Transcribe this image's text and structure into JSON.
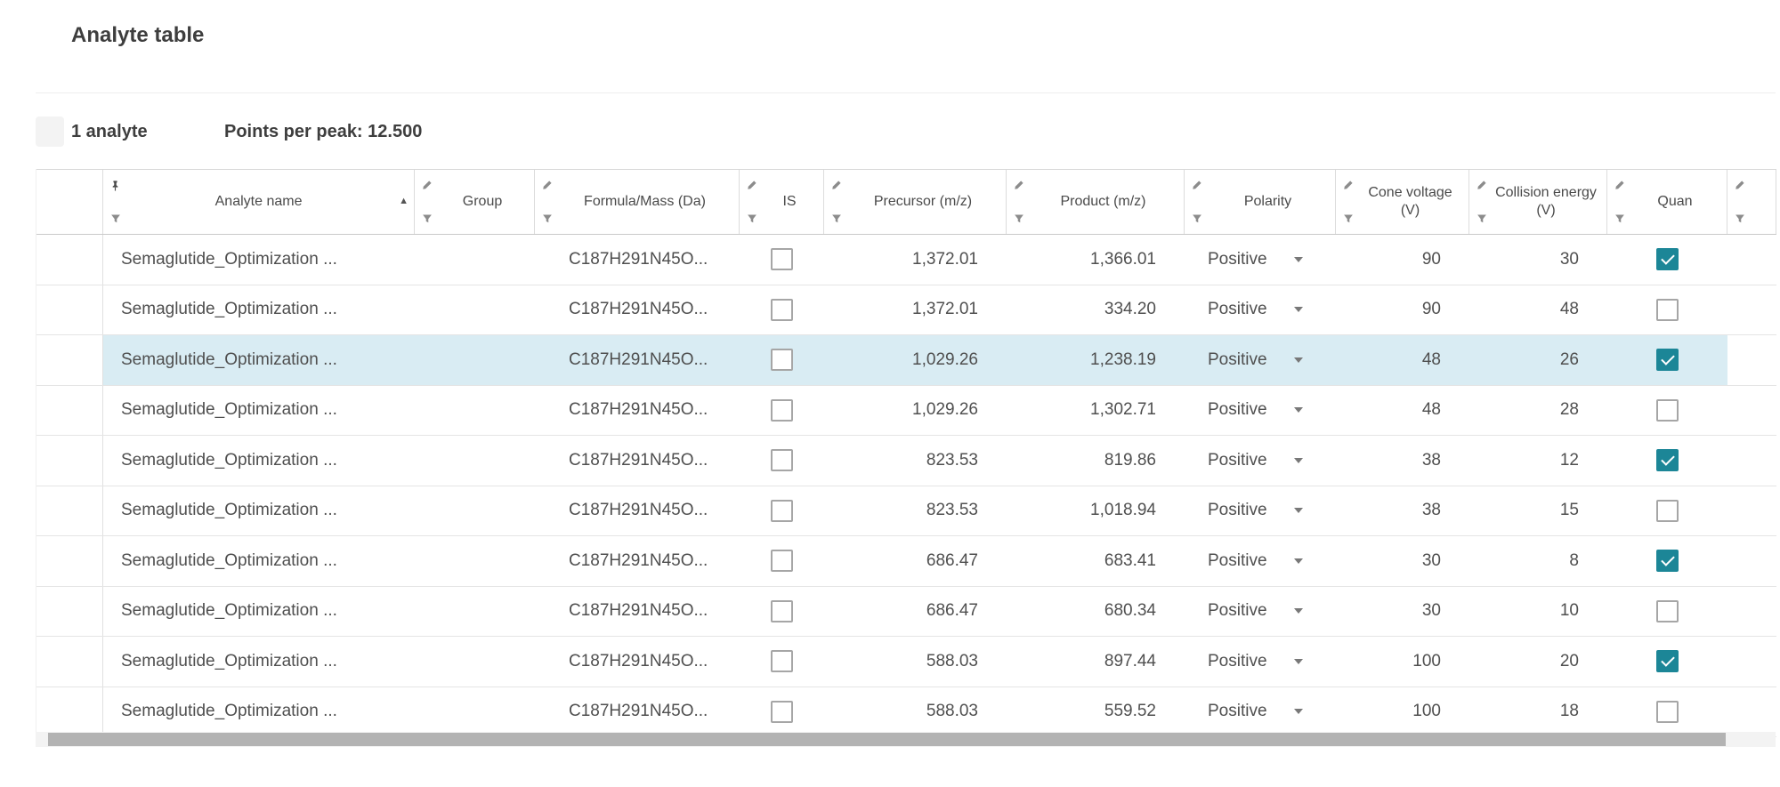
{
  "colors": {
    "accent": "#1c8697",
    "selected-row": "#d9ecf3"
  },
  "page": {
    "title": "Analyte table"
  },
  "summary": {
    "count": "1 analyte",
    "points_per_peak": "Points per peak: 12.500"
  },
  "table": {
    "columns": [
      {
        "key": "handle",
        "label": "",
        "icon": "",
        "filter": false
      },
      {
        "key": "name",
        "label": "Analyte name",
        "icon": "pin",
        "filter": true,
        "sort": "▲"
      },
      {
        "key": "group",
        "label": "Group",
        "icon": "pencil",
        "filter": true
      },
      {
        "key": "formula",
        "label": "Formula/Mass (Da)",
        "icon": "pencil",
        "filter": true
      },
      {
        "key": "is",
        "label": "IS",
        "icon": "pencil",
        "filter": true
      },
      {
        "key": "precursor",
        "label": "Precursor (m/z)",
        "icon": "pencil",
        "filter": true
      },
      {
        "key": "product",
        "label": "Product (m/z)",
        "icon": "pencil",
        "filter": true
      },
      {
        "key": "polarity",
        "label": "Polarity",
        "icon": "pencil",
        "filter": true
      },
      {
        "key": "cone",
        "label": "Cone voltage (V)",
        "icon": "pencil",
        "filter": true
      },
      {
        "key": "collision",
        "label": "Collision energy (V)",
        "icon": "pencil",
        "filter": true
      },
      {
        "key": "quan",
        "label": "Quan",
        "icon": "pencil",
        "filter": true
      },
      {
        "key": "overflow",
        "label": "",
        "icon": "pencil",
        "filter": true
      }
    ],
    "rows": [
      {
        "name": "Semaglutide_Optimization ...",
        "group": "",
        "formula": "C187H291N45O...",
        "is": false,
        "precursor": "1,372.01",
        "product": "1,366.01",
        "polarity": "Positive",
        "cone": "90",
        "collision": "30",
        "quan": true,
        "selected": false
      },
      {
        "name": "Semaglutide_Optimization ...",
        "group": "",
        "formula": "C187H291N45O...",
        "is": false,
        "precursor": "1,372.01",
        "product": "334.20",
        "polarity": "Positive",
        "cone": "90",
        "collision": "48",
        "quan": false,
        "selected": false
      },
      {
        "name": "Semaglutide_Optimization ...",
        "group": "",
        "formula": "C187H291N45O...",
        "is": false,
        "precursor": "1,029.26",
        "product": "1,238.19",
        "polarity": "Positive",
        "cone": "48",
        "collision": "26",
        "quan": true,
        "selected": true
      },
      {
        "name": "Semaglutide_Optimization ...",
        "group": "",
        "formula": "C187H291N45O...",
        "is": false,
        "precursor": "1,029.26",
        "product": "1,302.71",
        "polarity": "Positive",
        "cone": "48",
        "collision": "28",
        "quan": false,
        "selected": false
      },
      {
        "name": "Semaglutide_Optimization ...",
        "group": "",
        "formula": "C187H291N45O...",
        "is": false,
        "precursor": "823.53",
        "product": "819.86",
        "polarity": "Positive",
        "cone": "38",
        "collision": "12",
        "quan": true,
        "selected": false
      },
      {
        "name": "Semaglutide_Optimization ...",
        "group": "",
        "formula": "C187H291N45O...",
        "is": false,
        "precursor": "823.53",
        "product": "1,018.94",
        "polarity": "Positive",
        "cone": "38",
        "collision": "15",
        "quan": false,
        "selected": false
      },
      {
        "name": "Semaglutide_Optimization ...",
        "group": "",
        "formula": "C187H291N45O...",
        "is": false,
        "precursor": "686.47",
        "product": "683.41",
        "polarity": "Positive",
        "cone": "30",
        "collision": "8",
        "quan": true,
        "selected": false
      },
      {
        "name": "Semaglutide_Optimization ...",
        "group": "",
        "formula": "C187H291N45O...",
        "is": false,
        "precursor": "686.47",
        "product": "680.34",
        "polarity": "Positive",
        "cone": "30",
        "collision": "10",
        "quan": false,
        "selected": false
      },
      {
        "name": "Semaglutide_Optimization ...",
        "group": "",
        "formula": "C187H291N45O...",
        "is": false,
        "precursor": "588.03",
        "product": "897.44",
        "polarity": "Positive",
        "cone": "100",
        "collision": "20",
        "quan": true,
        "selected": false
      },
      {
        "name": "Semaglutide_Optimization ...",
        "group": "",
        "formula": "C187H291N45O...",
        "is": false,
        "precursor": "588.03",
        "product": "559.52",
        "polarity": "Positive",
        "cone": "100",
        "collision": "18",
        "quan": false,
        "selected": false
      }
    ]
  }
}
